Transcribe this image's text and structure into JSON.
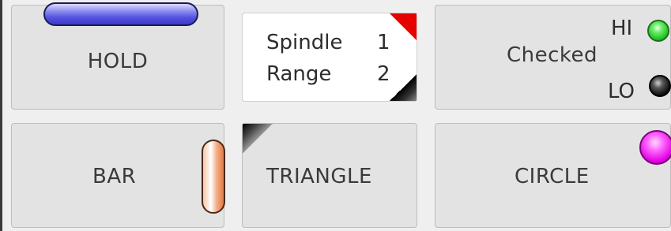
{
  "buttons": {
    "hold": {
      "label": "HOLD",
      "indicator_color": "#5555e0"
    },
    "bar": {
      "label": "BAR",
      "indicator_color": "#e27a44"
    },
    "triangle": {
      "label": "TRIANGLE",
      "indicator_color": "#000000"
    },
    "circle": {
      "label": "CIRCLE",
      "indicator_color": "#e000e0"
    },
    "checked": {
      "label": "Checked"
    }
  },
  "spindle_panel": {
    "rows": [
      {
        "label": "Spindle",
        "value": "1"
      },
      {
        "label": "Range",
        "value": "2"
      }
    ],
    "top_corner_color": "#e60000",
    "bottom_corner_color": "#000000"
  },
  "checked_leds": {
    "hi": {
      "label": "HI",
      "color": "#22c022",
      "icon": "green-led-icon"
    },
    "lo": {
      "label": "LO",
      "color": "#111111",
      "icon": "black-led-icon"
    }
  }
}
